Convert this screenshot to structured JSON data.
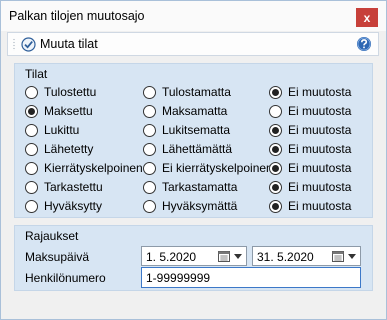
{
  "window": {
    "title": "Palkan tilojen muutosajo",
    "close_glyph": "x"
  },
  "toolbar": {
    "action_label": "Muuta tilat",
    "action_icon": "check-circle-icon",
    "help_icon": "help-icon"
  },
  "tilat": {
    "title": "Tilat",
    "rows": [
      {
        "left": "Tulostettu",
        "middle": "Tulostamatta",
        "right": "Ei muutosta",
        "selected": "right"
      },
      {
        "left": "Maksettu",
        "middle": "Maksamatta",
        "right": "Ei muutosta",
        "selected": "left"
      },
      {
        "left": "Lukittu",
        "middle": "Lukitsematta",
        "right": "Ei muutosta",
        "selected": "right"
      },
      {
        "left": "Lähetetty",
        "middle": "Lähettämättä",
        "right": "Ei muutosta",
        "selected": "right"
      },
      {
        "left": "Kierrätyskelpoinen",
        "middle": "Ei kierrätyskelpoinen",
        "right": "Ei muutosta",
        "selected": "right"
      },
      {
        "left": "Tarkastettu",
        "middle": "Tarkastamatta",
        "right": "Ei muutosta",
        "selected": "right"
      },
      {
        "left": "Hyväksytty",
        "middle": "Hyväksymättä",
        "right": "Ei muutosta",
        "selected": "right"
      }
    ]
  },
  "rajaukset": {
    "title": "Rajaukset",
    "maksupaiva_label": "Maksupäivä",
    "date_from": "1.  5.2020",
    "date_to": "31.  5.2020",
    "henkilonumero_label": "Henkilönumero",
    "henkilonumero_value": "1-99999999"
  },
  "colors": {
    "group_bg": "#d7e5f3",
    "close_bg": "#c7403a",
    "accent": "#3c78c8"
  }
}
